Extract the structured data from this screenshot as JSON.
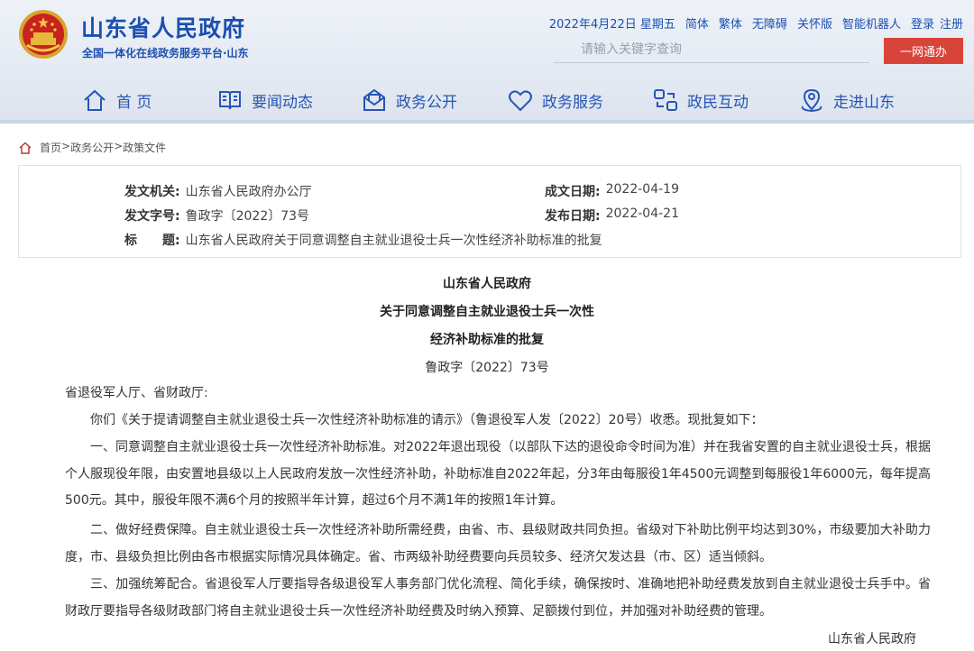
{
  "header": {
    "site_title": "山东省人民政府",
    "site_subtitle": "全国一体化在线政务服务平台·山东",
    "top_links": [
      "2022年4月22日 星期五",
      "简体",
      "繁体",
      "无障碍",
      "关怀版",
      "智能机器人",
      "登录",
      "注册"
    ],
    "search_placeholder": "请输入关键字查询",
    "yiwang_button": "一网通办",
    "brand_color": "#1b4fb0",
    "accent_color": "#d9443a"
  },
  "nav": {
    "items": [
      {
        "label": "首 页",
        "icon": "home-icon"
      },
      {
        "label": "要闻动态",
        "icon": "book-icon"
      },
      {
        "label": "政务公开",
        "icon": "mail-icon"
      },
      {
        "label": "政务服务",
        "icon": "heart-icon"
      },
      {
        "label": "政民互动",
        "icon": "interaction-icon"
      },
      {
        "label": "走进山东",
        "icon": "location-icon"
      }
    ]
  },
  "breadcrumb": {
    "items": [
      "首页",
      ">",
      "政务公开",
      ">",
      "政策文件"
    ]
  },
  "info": {
    "issuer_label": "发文机关:",
    "issuer": "山东省人民政府办公厅",
    "docno_label": "发文字号:",
    "docno": "鲁政字〔2022〕73号",
    "title_label": "标　　题:",
    "title": "山东省人民政府关于同意调整自主就业退役士兵一次性经济补助标准的批复",
    "written_label": "成文日期:",
    "written_date": "2022-04-19",
    "published_label": "发布日期:",
    "published_date": "2022-04-21"
  },
  "article": {
    "title_lines": [
      "山东省人民政府",
      "关于同意调整自主就业退役士兵一次性",
      "经济补助标准的批复"
    ],
    "doc_number": "鲁政字〔2022〕73号",
    "salutation": "省退役军人厅、省财政厅:",
    "paragraphs": [
      "你们《关于提请调整自主就业退役士兵一次性经济补助标准的请示》（鲁退役军人发〔2022〕20号）收悉。现批复如下：",
      "一、同意调整自主就业退役士兵一次性经济补助标准。对2022年退出现役（以部队下达的退役命令时间为准）并在我省安置的自主就业退役士兵，根据个人服现役年限，由安置地县级以上人民政府发放一次性经济补助，补助标准自2022年起，分3年由每服役1年4500元调整到每服役1年6000元，每年提高500元。其中，服役年限不满6个月的按照半年计算，超过6个月不满1年的按照1年计算。",
      "二、做好经费保障。自主就业退役士兵一次性经济补助所需经费，由省、市、县级财政共同负担。省级对下补助比例平均达到30%，市级要加大补助力度，市、县级负担比例由各市根据实际情况具体确定。省、市两级补助经费要向兵员较多、经济欠发达县（市、区）适当倾斜。",
      "三、加强统筹配合。省退役军人厅要指导各级退役军人事务部门优化流程、简化手续，确保按时、准确地把补助经费发放到自主就业退役士兵手中。省财政厅要指导各级财政部门将自主就业退役士兵一次性经济补助经费及时纳入预算、足额拨付到位，并加强对补助经费的管理。"
    ],
    "signature": "山东省人民政府"
  }
}
